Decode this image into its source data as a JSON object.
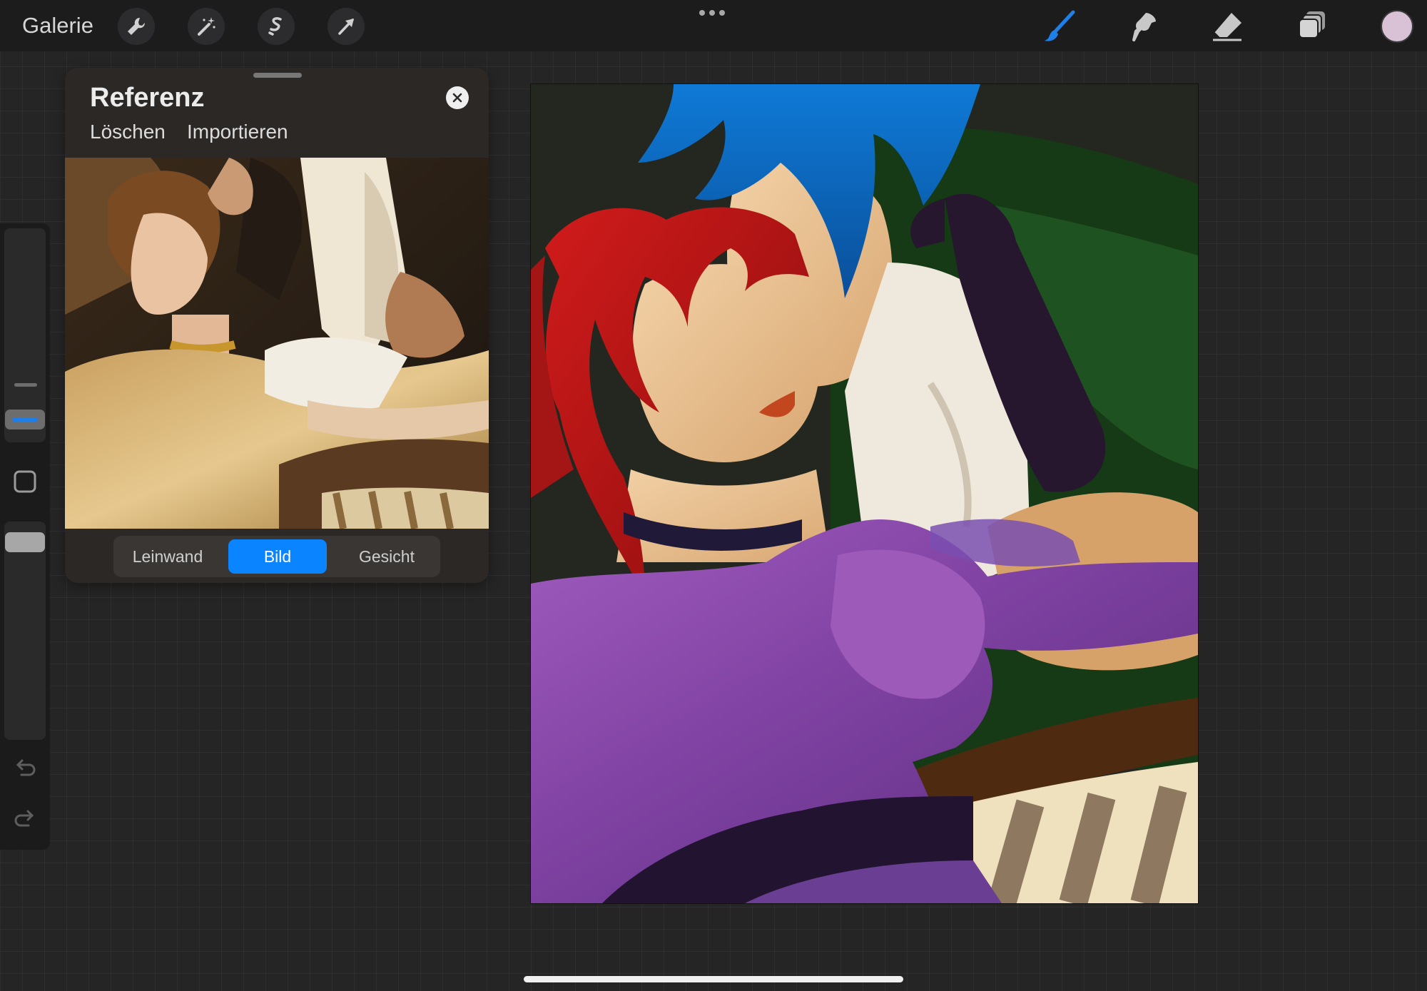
{
  "toolbar": {
    "gallery_label": "Galerie",
    "left_tools": [
      "wrench-icon",
      "magic-wand-icon",
      "selection-icon",
      "transform-arrow-icon"
    ],
    "right_tools": [
      "brush-icon",
      "smudge-icon",
      "eraser-icon",
      "layers-icon"
    ],
    "active_tool": "brush-icon",
    "more_icon": "more-dots-icon",
    "current_color": "#d9c1d6",
    "accent_color": "#1e7fe8"
  },
  "sidebar": {
    "brush_size_slider": "brush-size-slider",
    "modify_button": "square-icon",
    "opacity_slider": "opacity-slider",
    "undo_icon": "undo-icon",
    "redo_icon": "redo-icon"
  },
  "reference_panel": {
    "title": "Referenz",
    "actions": {
      "clear": "Löschen",
      "import": "Importieren"
    },
    "tabs": [
      "Leinwand",
      "Bild",
      "Gesicht"
    ],
    "active_tab": "Bild",
    "active_color": "#0a84ff"
  }
}
